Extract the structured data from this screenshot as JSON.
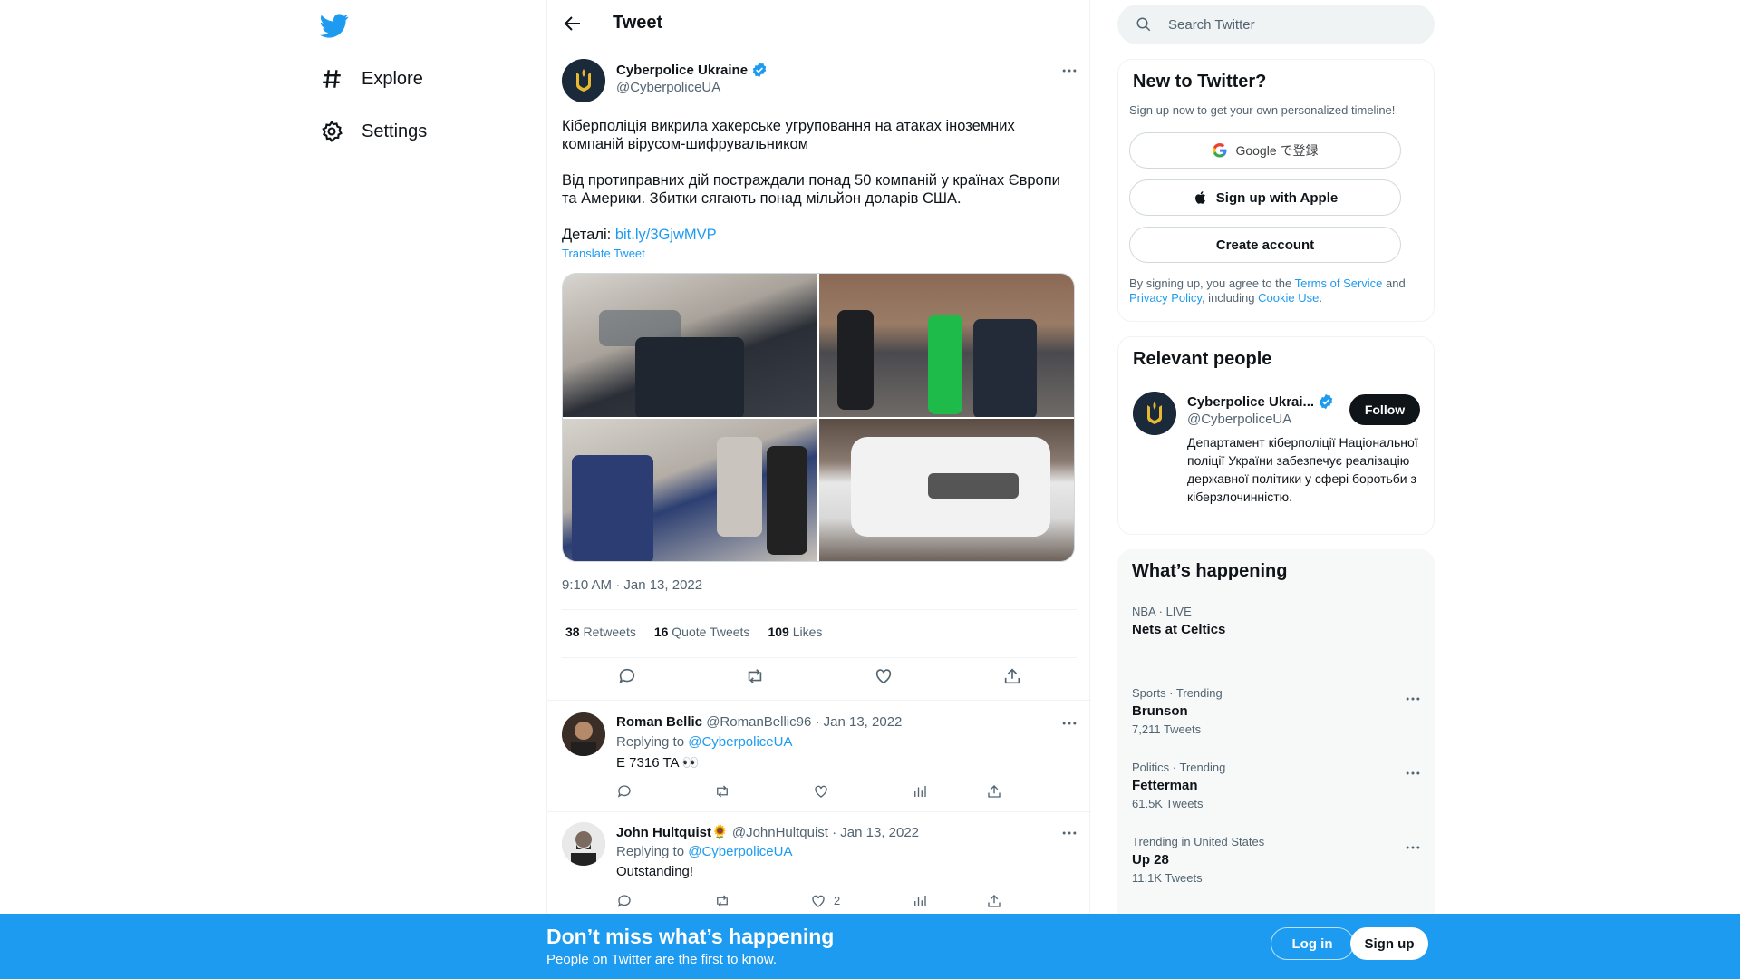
{
  "nav": {
    "items": [
      {
        "label": "Explore"
      },
      {
        "label": "Settings"
      }
    ]
  },
  "header": {
    "title": "Tweet"
  },
  "tweet": {
    "author_name": "Cyberpolice Ukraine",
    "author_handle": "@CyberpoliceUA",
    "text_p1": "Кіберполіція викрила хакерське угруповання на атаках іноземних компаній вірусом-шифрувальником",
    "text_p2": "Від протиправних дій постраждали понад 50 компаній у країнах Європи та Америки. Збитки сягають понад мільйон доларів США.",
    "details_label": "Деталі:",
    "details_link": "bit.ly/3GjwMVP",
    "translate_label": "Translate Tweet",
    "timestamp": "9:10 AM · Jan 13, 2022",
    "stats": {
      "retweets_count": "38",
      "retweets_label": "Retweets",
      "quotes_count": "16",
      "quotes_label": "Quote Tweets",
      "likes_count": "109",
      "likes_label": "Likes"
    }
  },
  "replies": [
    {
      "name": "Roman Bellic",
      "handle_date": "@RomanBellic96 · Jan 13, 2022",
      "replying_label": "Replying to",
      "replying_to": "@CyberpoliceUA",
      "text": "E 7316 TA 👀",
      "likes": ""
    },
    {
      "name": "John Hultquist🌻",
      "handle_date": "@JohnHultquist · Jan 13, 2022",
      "replying_label": "Replying to",
      "replying_to": "@CyberpoliceUA",
      "text": "Outstanding!",
      "likes": "2"
    }
  ],
  "search": {
    "placeholder": "Search Twitter"
  },
  "signup_card": {
    "title": "New to Twitter?",
    "subtitle": "Sign up now to get your own personalized timeline!",
    "google_label": "Google で登録",
    "apple_label": "Sign up with Apple",
    "create_label": "Create account",
    "legal_1": "By signing up, you agree to the ",
    "terms": "Terms of Service",
    "legal_2": " and ",
    "privacy": "Privacy Policy",
    "legal_3": ", including ",
    "cookie": "Cookie Use",
    "legal_4": "."
  },
  "relevant": {
    "title": "Relevant people",
    "name": "Cyberpolice Ukrai...",
    "handle": "@CyberpoliceUA",
    "follow_label": "Follow",
    "bio": "Департамент кіберполіції Національної поліції України забезпечує реалізацію державної політики у сфері боротьби з кіберзлочинністю."
  },
  "happening": {
    "title": "What’s happening",
    "trends": [
      {
        "meta": "NBA · LIVE",
        "name": "Nets at Celtics",
        "count": ""
      },
      {
        "meta": "Sports · Trending",
        "name": "Brunson",
        "count": "7,211 Tweets"
      },
      {
        "meta": "Politics · Trending",
        "name": "Fetterman",
        "count": "61.5K Tweets"
      },
      {
        "meta": "Trending in United States",
        "name": "Up 28",
        "count": "11.1K Tweets"
      }
    ]
  },
  "bottom_bar": {
    "title": "Don’t miss what’s happening",
    "subtitle": "People on Twitter are the first to know.",
    "login_label": "Log in",
    "signup_label": "Sign up"
  },
  "colors": {
    "accent": "#1d9bf0",
    "text": "#0f1419",
    "secondary": "#536471"
  },
  "icons": [
    "twitter-logo-icon",
    "hashtag-icon",
    "gear-icon",
    "back-arrow-icon",
    "verified-icon",
    "more-icon",
    "reply-icon",
    "retweet-icon",
    "like-icon",
    "share-icon",
    "analytics-icon",
    "search-icon",
    "google-icon",
    "apple-icon"
  ]
}
